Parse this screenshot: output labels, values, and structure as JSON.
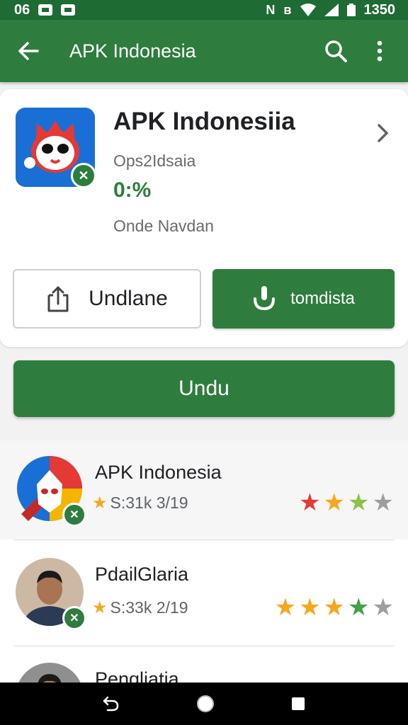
{
  "status_bar": {
    "time": "06",
    "clock": "1350"
  },
  "app_bar": {
    "title": "APK Indonesia"
  },
  "app_card": {
    "name": "APK Indonesiia",
    "developer": "Ops2Idsaia",
    "percent": "0:%",
    "subtitle": "Onde Navdan",
    "install_button_label": "Undlane",
    "download_button_label": "tomdista"
  },
  "main_button": {
    "label": "Undu"
  },
  "list": {
    "items": [
      {
        "name": "APK Indonesia",
        "meta": "S:31k 3/19",
        "stars": [
          "#e53935",
          "#f4a81d",
          "#8bc34a",
          "#9e9e9e"
        ]
      },
      {
        "name": "PdailGlaria",
        "meta": "S:33k 2/19",
        "stars": [
          "#f4a81d",
          "#f4a81d",
          "#f4a81d",
          "#43a047",
          "#9e9e9e"
        ]
      },
      {
        "name": "Pengliatia"
      }
    ]
  },
  "colors": {
    "primary": "#2e7d3e",
    "status_bar": "#1e6b33",
    "star": "#f4a81d"
  }
}
